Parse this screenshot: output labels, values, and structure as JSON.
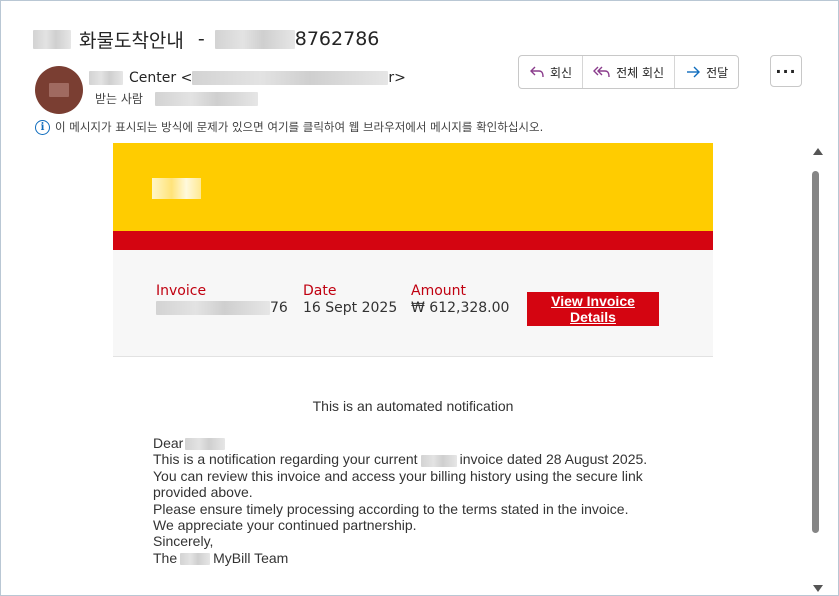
{
  "subject": {
    "prefix": "화물도착안내",
    "separator": "-",
    "number_suffix": "8762786"
  },
  "sender": {
    "name": "Center <",
    "email_suffix": "r>"
  },
  "recipients": {
    "label": "받는 사람"
  },
  "actions": {
    "reply": "회신",
    "reply_all": "전체 회신",
    "forward": "전달",
    "more": "···"
  },
  "info_bar": {
    "text": "이 메시지가 표시되는 방식에 문제가 있으면 여기를 클릭하여 웹 브라우저에서 메시지를 확인하십시오."
  },
  "invoice": {
    "invoice_label": "Invoice",
    "invoice_suffix": "76",
    "date_label": "Date",
    "date_value": "16 Sept 2025",
    "amount_label": "Amount",
    "amount_value": "₩ 612,328.00",
    "cta": "View Invoice Details"
  },
  "email": {
    "notice": "This is an automated notification",
    "greeting": "Dear",
    "line1_a": "This is a notification regarding your current",
    "line1_b": "invoice dated 28 August 2025.",
    "line2": "You can review this invoice and access your billing history using the secure link",
    "line3": "provided above.",
    "line4": "Please ensure timely processing according to the terms stated in the invoice.",
    "line5": "We appreciate your continued partnership.",
    "line6": "Sincerely,",
    "sign_a": "The",
    "sign_b": "MyBill Team"
  },
  "colors": {
    "brand_yellow": "#ffcc00",
    "brand_red": "#d40511",
    "link_blue": "#0f6cbd"
  }
}
